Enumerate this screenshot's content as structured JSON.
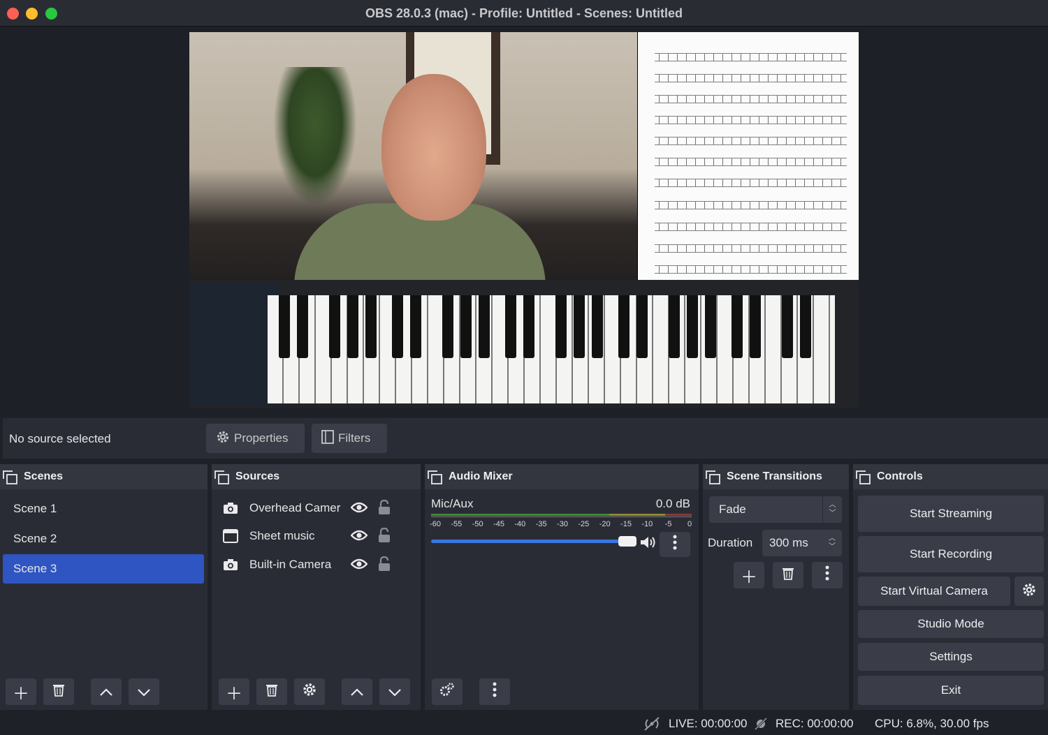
{
  "window": {
    "title": "OBS 28.0.3 (mac) - Profile: Untitled - Scenes: Untitled"
  },
  "source_toolbar": {
    "status": "No source selected",
    "properties_label": "Properties",
    "filters_label": "Filters"
  },
  "scenes": {
    "title": "Scenes",
    "items": [
      {
        "label": "Scene 1",
        "selected": false
      },
      {
        "label": "Scene 2",
        "selected": false
      },
      {
        "label": "Scene 3",
        "selected": true
      }
    ]
  },
  "sources": {
    "title": "Sources",
    "items": [
      {
        "label": "Overhead Camer",
        "icon": "camera-icon"
      },
      {
        "label": "Sheet music",
        "icon": "window-capture-icon"
      },
      {
        "label": "Built-in Camera",
        "icon": "camera-icon"
      }
    ]
  },
  "audio_mixer": {
    "title": "Audio Mixer",
    "channel": "Mic/Aux",
    "level": "0.0 dB",
    "ticks": [
      "-60",
      "-55",
      "-50",
      "-45",
      "-40",
      "-35",
      "-30",
      "-25",
      "-20",
      "-15",
      "-10",
      "-5",
      "0"
    ],
    "volume_fraction": 1.0
  },
  "scene_transitions": {
    "title": "Scene Transitions",
    "transition": "Fade",
    "duration_label": "Duration",
    "duration_value": "300 ms"
  },
  "controls": {
    "title": "Controls",
    "start_streaming": "Start Streaming",
    "start_recording": "Start Recording",
    "start_virtual_camera": "Start Virtual Camera",
    "studio_mode": "Studio Mode",
    "settings": "Settings",
    "exit": "Exit"
  },
  "status": {
    "live": "LIVE: 00:00:00",
    "rec": "REC: 00:00:00",
    "cpu": "CPU: 6.8%, 30.00 fps"
  },
  "colors": {
    "accent": "#2f55c2",
    "slider": "#3a77e0",
    "panel": "#2a2c35",
    "button": "#3a3d47"
  }
}
